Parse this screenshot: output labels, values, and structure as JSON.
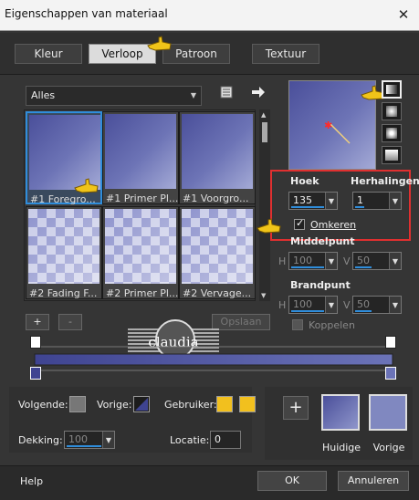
{
  "window": {
    "title": "Eigenschappen van materiaal",
    "close_glyph": "✕"
  },
  "tabs": [
    {
      "label": "Kleur",
      "active": false
    },
    {
      "label": "Verloop",
      "active": true
    },
    {
      "label": "Patroon",
      "active": false
    },
    {
      "label": "Textuur",
      "active": false
    }
  ],
  "library": {
    "category": "Alles",
    "items": [
      {
        "label": "#1 Foregro...",
        "selected": true
      },
      {
        "label": "#1 Primer Pl...",
        "selected": false
      },
      {
        "label": "#1 Voorgro...",
        "selected": false
      },
      {
        "label": "#2 Fading F...",
        "selected": false
      },
      {
        "label": "#2 Primer Pl...",
        "selected": false
      },
      {
        "label": "#2 Vervage...",
        "selected": false
      }
    ],
    "add_label": "+",
    "remove_label": "-",
    "delete_label": "Opslaan"
  },
  "gradient": {
    "angle_label": "Hoek",
    "angle_value": "135",
    "repeats_label": "Herhalingen",
    "repeats_value": "1",
    "invert_label": "Omkeren",
    "invert_checked": true,
    "center_label": "Middelpunt",
    "center_h": "100",
    "center_v": "50",
    "focal_label": "Brandpunt",
    "focal_h": "100",
    "focal_v": "50",
    "link_label": "Koppelen",
    "h_label": "H",
    "v_label": "V"
  },
  "stops": {
    "following_label": "Volgende:",
    "previous_label": "Vorige:",
    "user_label": "Gebruiker:",
    "opacity_label": "Dekking:",
    "opacity_value": "100",
    "location_label": "Locatie:",
    "location_value": "0"
  },
  "current": {
    "current_label": "Huidige",
    "previous_label": "Vorige"
  },
  "footer": {
    "help": "Help",
    "ok": "OK",
    "cancel": "Annuleren"
  },
  "watermark": {
    "text": "claudia"
  },
  "colors": {
    "accent": "#2f8ddb",
    "gradient_start": "#4a4f9a",
    "gradient_end": "#a4aad6",
    "highlight_box": "#e03030",
    "user_swatch": "#f2c01e"
  },
  "icons": [
    "refresh-icon",
    "arrow-right-icon",
    "linear-gradient-icon",
    "radial-gradient-icon",
    "rectangular-gradient-icon",
    "sunburst-gradient-icon",
    "add-icon",
    "hand-pointer-icon",
    "checkbox-icon"
  ]
}
